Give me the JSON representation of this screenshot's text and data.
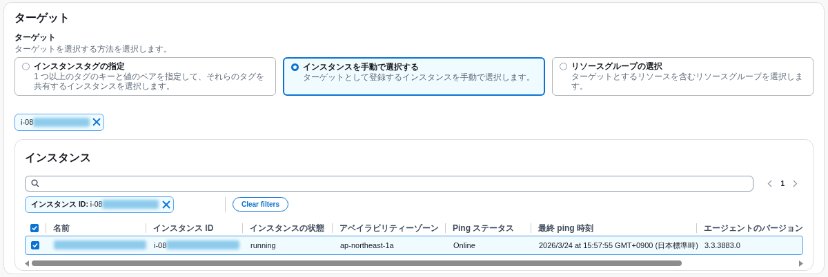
{
  "target": {
    "title": "ターゲット",
    "field_label": "ターゲット",
    "field_description": "ターゲットを選択する方法を選択します。",
    "options": [
      {
        "label": "インスタンスタグの指定",
        "description": "1 つ以上のタグのキーと値のペアを指定して、それらのタグを共有するインスタンスを選択します。",
        "selected": false
      },
      {
        "label": "インスタンスを手動で選択する",
        "description": "ターゲットとして登録するインスタンスを手動で選択します。",
        "selected": true
      },
      {
        "label": "リソースグループの選択",
        "description": "ターゲットとするリソースを含むリソースグループを選択します。",
        "selected": false
      }
    ],
    "selected_tokens": [
      {
        "text": "i-08",
        "redacted": true
      }
    ]
  },
  "instances": {
    "title": "インスタンス",
    "pagination": {
      "page": "1"
    },
    "filters": [
      {
        "label": "インスタンス ID:",
        "value": "i-08",
        "redacted": true
      }
    ],
    "clear_button": "Clear filters",
    "table": {
      "select_all": true,
      "columns": [
        "名前",
        "インスタンス ID",
        "インスタンスの状態",
        "アベイラビリティーゾーン",
        "Ping ステータス",
        "最終 ping 時刻",
        "エージェントのバージョン"
      ],
      "rows": [
        {
          "selected": true,
          "cells": [
            {
              "redacted": true
            },
            {
              "text": "i-08",
              "redacted": true
            },
            {
              "text": "running"
            },
            {
              "text": "ap-northeast-1a"
            },
            {
              "text": "Online"
            },
            {
              "text": "2026/3/24 at 15:57:55 GMT+0900 (日本標準時)"
            },
            {
              "text": "3.3.3883.0"
            }
          ]
        }
      ]
    }
  }
}
